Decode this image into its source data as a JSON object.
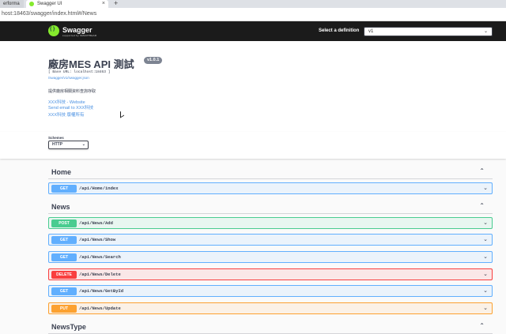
{
  "browser": {
    "tabs": [
      {
        "label": "erforma",
        "active": false
      },
      {
        "label": "Swagger UI",
        "active": true
      }
    ],
    "new_tab": "+",
    "close": "×",
    "url": "host:18463/swagger/index.html#/News"
  },
  "topbar": {
    "logo_text": "Swagger",
    "logo_sub": "supported by SMARTBEAR",
    "definition_label": "Select a definition",
    "definition_value": "v1"
  },
  "info": {
    "title": "廠房MES API 測試",
    "version": "v1.0.1",
    "base_url": "[ Base URL: localhost:18463 ]",
    "json_link": "/swagger/v1/swagger.json",
    "description": "提供廠房相關資料查詢存取",
    "links": [
      "XXX科技 - Website",
      "Send email to XXX科技",
      "XXX科技 版權所有"
    ]
  },
  "schemes": {
    "label": "Schemes",
    "value": "HTTP"
  },
  "colors": {
    "get": "#61affe",
    "get_bg": "#ebf3fb",
    "get_border": "#61affe",
    "post": "#49cc90",
    "post_bg": "#e8f6f0",
    "post_border": "#49cc90",
    "delete": "#f93e3e",
    "delete_bg": "#fae7e7",
    "delete_border": "#f93e3e",
    "put": "#fca130",
    "put_bg": "#fbf1e6",
    "put_border": "#fca130"
  },
  "groups": [
    {
      "name": "Home",
      "ops": [
        {
          "method": "GET",
          "path": "/api/Home/index"
        }
      ]
    },
    {
      "name": "News",
      "ops": [
        {
          "method": "POST",
          "path": "/api/News/Add"
        },
        {
          "method": "GET",
          "path": "/api/News/Show"
        },
        {
          "method": "GET",
          "path": "/api/News/Search"
        },
        {
          "method": "DELETE",
          "path": "/api/News/Delete"
        },
        {
          "method": "GET",
          "path": "/api/News/GetById"
        },
        {
          "method": "PUT",
          "path": "/api/News/Update"
        }
      ]
    },
    {
      "name": "NewsType",
      "ops": []
    }
  ]
}
